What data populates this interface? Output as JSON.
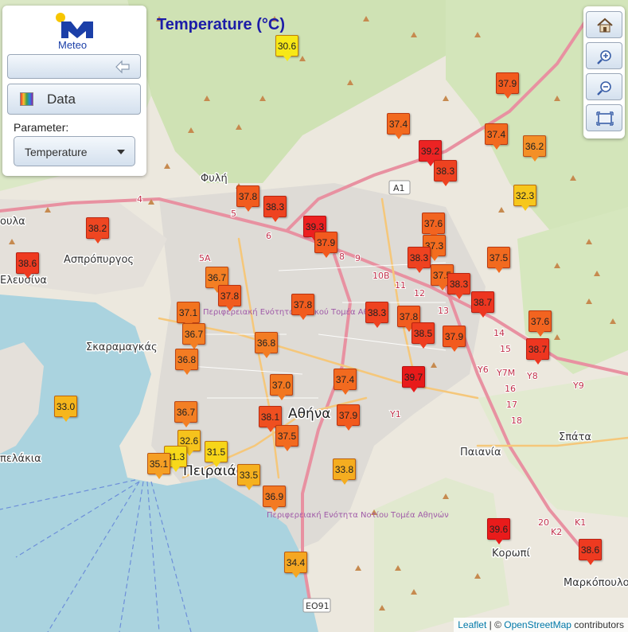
{
  "app": {
    "logo_text": "Meteo"
  },
  "panel": {
    "data_label": "Data",
    "parameter_label": "Parameter:",
    "parameter_value": "Temperature"
  },
  "map": {
    "title": "Temperature (°C)",
    "place_labels": [
      "Φυλή",
      "Ασπρόπυργος",
      "Ελευσίνα",
      "Σκαραμαγκάς",
      "Αθήνα",
      "Πειραιάς",
      "Παιανία",
      "Σπάτα",
      "Κορωπί",
      "Μαρκόπουλο",
      "Περιφερειακή Ενότητα Δυτικού Τομέα Αθηνών",
      "Περιφερειακή Ενότητα Νοτίου Τομέα Αθηνών",
      "ουλα",
      "πελάκια"
    ],
    "road_labels": [
      "A1",
      "ΕΟ91",
      "4",
      "5",
      "6",
      "8",
      "9",
      "10B",
      "11",
      "12",
      "13",
      "14",
      "15",
      "Y6",
      "Y7M",
      "Y8",
      "Y9",
      "16",
      "17",
      "18",
      "20",
      "K1",
      "K2",
      "5A",
      "Y1"
    ],
    "zoom_buttons": [
      "home-icon",
      "zoom-in-icon",
      "zoom-out-icon",
      "fullscreen-icon"
    ]
  },
  "temperature_markers": [
    {
      "value": "30.6",
      "color": "#f7e817"
    },
    {
      "value": "37.9",
      "color": "#f25a1e"
    },
    {
      "value": "37.4",
      "color": "#f26a1f"
    },
    {
      "value": "39.2",
      "color": "#ec2323"
    },
    {
      "value": "38.3",
      "color": "#ee4220"
    },
    {
      "value": "37.4",
      "color": "#f26a1f"
    },
    {
      "value": "36.2",
      "color": "#f38f27"
    },
    {
      "value": "32.3",
      "color": "#f6c71c"
    },
    {
      "value": "37.8",
      "color": "#f15c1e"
    },
    {
      "value": "38.3",
      "color": "#ee4220"
    },
    {
      "value": "39.3",
      "color": "#ec2020"
    },
    {
      "value": "37.9",
      "color": "#f25a1e"
    },
    {
      "value": "38.2",
      "color": "#ef4621"
    },
    {
      "value": "38.6",
      "color": "#ee3a20"
    },
    {
      "value": "37.6",
      "color": "#f26420"
    },
    {
      "value": "37.3",
      "color": "#f36d1f"
    },
    {
      "value": "38.3",
      "color": "#ee4220"
    },
    {
      "value": "37.5",
      "color": "#f26a1f"
    },
    {
      "value": "37.5",
      "color": "#f26a1f"
    },
    {
      "value": "38.3",
      "color": "#ee4220"
    },
    {
      "value": "38.7",
      "color": "#ed3620"
    },
    {
      "value": "36.7",
      "color": "#f37f24"
    },
    {
      "value": "37.8",
      "color": "#f15c1e"
    },
    {
      "value": "37.8",
      "color": "#f15c1e"
    },
    {
      "value": "38.3",
      "color": "#ee4220"
    },
    {
      "value": "37.8",
      "color": "#f15c1e"
    },
    {
      "value": "38.5",
      "color": "#ee3e20"
    },
    {
      "value": "37.9",
      "color": "#f25a1e"
    },
    {
      "value": "37.6",
      "color": "#f26420"
    },
    {
      "value": "38.7",
      "color": "#ed3620"
    },
    {
      "value": "37.1",
      "color": "#f27420"
    },
    {
      "value": "36.7",
      "color": "#f37f24"
    },
    {
      "value": "36.8",
      "color": "#f37c23"
    },
    {
      "value": "36.8",
      "color": "#f37c23"
    },
    {
      "value": "37.0",
      "color": "#f27720"
    },
    {
      "value": "37.4",
      "color": "#f26a1f"
    },
    {
      "value": "39.7",
      "color": "#e81a1a"
    },
    {
      "value": "33.0",
      "color": "#f6b61c"
    },
    {
      "value": "36.7",
      "color": "#f37f24"
    },
    {
      "value": "38.1",
      "color": "#ef4f20"
    },
    {
      "value": "37.5",
      "color": "#f26a1f"
    },
    {
      "value": "37.9",
      "color": "#f25a1e"
    },
    {
      "value": "32.6",
      "color": "#f6c31c"
    },
    {
      "value": "31.3",
      "color": "#f7d91a"
    },
    {
      "value": "31.5",
      "color": "#f7d519"
    },
    {
      "value": "35.1",
      "color": "#f59f24"
    },
    {
      "value": "33.5",
      "color": "#f5b11f"
    },
    {
      "value": "36.9",
      "color": "#f37a22"
    },
    {
      "value": "33.8",
      "color": "#f5ad20"
    },
    {
      "value": "39.6",
      "color": "#e91b1b"
    },
    {
      "value": "38.6",
      "color": "#ee3a20"
    },
    {
      "value": "34.4",
      "color": "#f5a722"
    }
  ],
  "attribution": {
    "leaflet": "Leaflet",
    "sep": " | © ",
    "osm": "OpenStreetMap",
    "tail": " contributors"
  }
}
